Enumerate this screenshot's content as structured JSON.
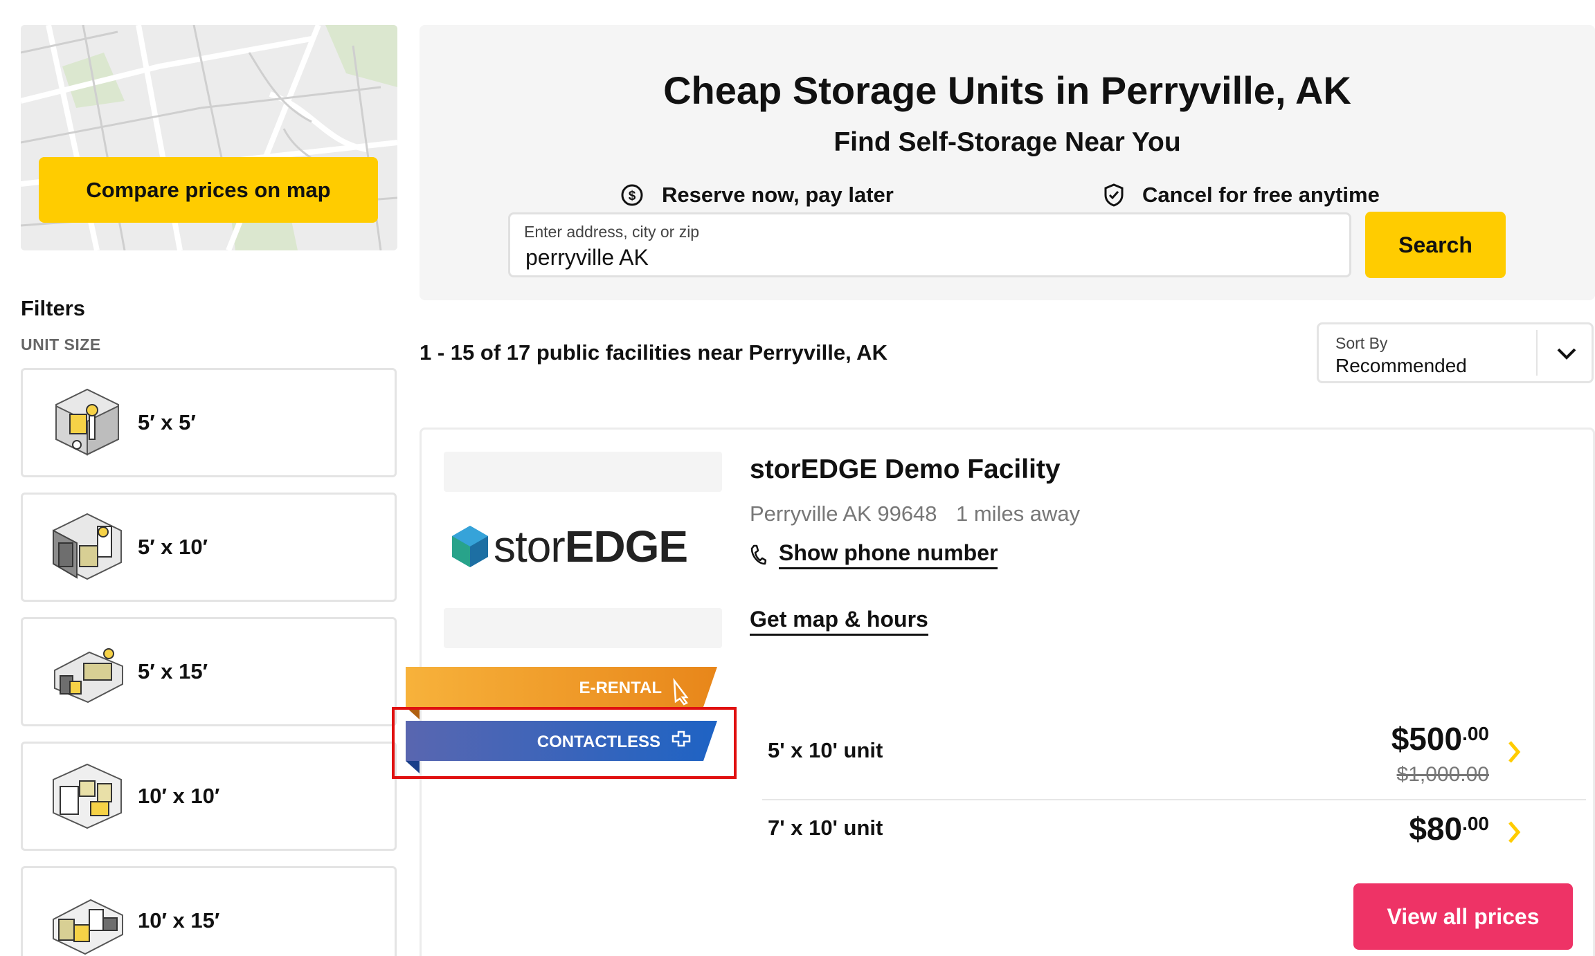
{
  "map_card": {
    "button_label": "Compare prices on map"
  },
  "filters": {
    "title": "Filters",
    "unit_size_label": "UNIT SIZE",
    "sizes": [
      "5′ x 5′",
      "5′ x 10′",
      "5′ x 15′",
      "10′ x 10′",
      "10′ x 15′"
    ]
  },
  "hero": {
    "title": "Cheap Storage Units in Perryville, AK",
    "subtitle": "Find Self-Storage Near You",
    "perk_1": "Reserve now, pay later",
    "perk_2": "Cancel for free anytime",
    "search_label": "Enter address, city or zip",
    "search_value": "perryville AK",
    "search_button": "Search"
  },
  "results": {
    "count_text": "1 - 15 of 17 public facilities near Perryville, AK",
    "sort_label": "Sort By",
    "sort_value": "Recommended"
  },
  "facility": {
    "logo_text_light": "stor",
    "logo_text_bold": "EDGE",
    "name": "storEDGE Demo Facility",
    "address": "Perryville AK 99648",
    "distance": "1 miles away",
    "phone_link": "Show phone number",
    "map_link": "Get map & hours",
    "badges": {
      "erental": "E-RENTAL",
      "contactless": "CONTACTLESS"
    },
    "units": [
      {
        "name": "5' x 10' unit",
        "price_main": "$500",
        "price_cents": ".00",
        "old_price": "$1,000.00"
      },
      {
        "name": "7' x 10' unit",
        "price_main": "$80",
        "price_cents": ".00"
      }
    ],
    "view_all_button": "View all prices"
  },
  "colors": {
    "accent_yellow": "#ffcc00",
    "cta_pink": "#ee3366",
    "erental_orange": "#f0921c",
    "contactless_blue": "#3a63b8",
    "highlight_red": "#e01010"
  }
}
